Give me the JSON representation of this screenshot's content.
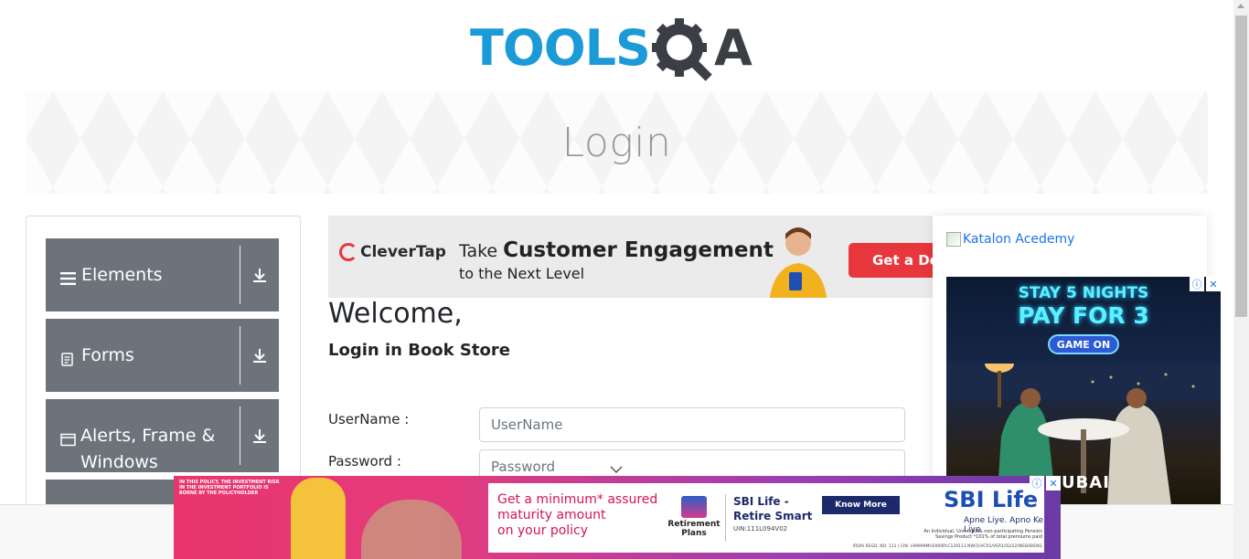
{
  "logo": {
    "tools": "TOOLS",
    "qa": "A"
  },
  "banner": {
    "title": "Login"
  },
  "sidebar": {
    "groups": [
      {
        "label": "Elements",
        "icon": "hamburger-icon"
      },
      {
        "label": "Forms",
        "icon": "document-icon"
      },
      {
        "label": "Alerts, Frame & Windows",
        "icon": "window-icon"
      }
    ]
  },
  "top_ad": {
    "brand": "CleverTap",
    "line1_prefix": "Take",
    "line1_bold": "Customer Engagement",
    "line2": "to the Next Level",
    "cta": "Get a De"
  },
  "login": {
    "welcome": "Welcome,",
    "subtitle": "Login in Book Store",
    "username_label": "UserName :",
    "username_placeholder": "UserName",
    "password_label": "Password :",
    "password_placeholder": "Password"
  },
  "right_sidebar": {
    "katalon_alt": "Katalon Acedemy",
    "ad": {
      "line1": "STAY 5 NIGHTS",
      "line2": "PAY FOR 3",
      "button": "GAME ON",
      "brand": "DUBAI"
    }
  },
  "bottom_ad": {
    "disclaimer": "IN THIS POLICY, THE INVESTMENT RISK IN THE INVESTMENT PORTFOLIO IS BORNE BY THE POLICYHOLDER",
    "copy_line1": "Get a minimum* assured",
    "copy_line2": "maturity amount",
    "copy_line3": "on your policy",
    "rp_line1": "Retirement",
    "rp_line2": "Plans",
    "product_line1": "SBI Life -",
    "product_line2": "Retire Smart",
    "uin": "UIN:111L094V02",
    "know_more": "Know More",
    "logo": "SBI Life",
    "tagline": "Apne Liye. Apno Ke Liye.",
    "fine_print": "An Individual, Unit-linked, non-participating Pension Savings Product *101% of total premiums paid",
    "irda": "IRDAI REGD. NO. 111 | CIN: L99999MH2000PLC129113 NW/1H/CR1/VER1/02/22/WEB/B/ENG"
  },
  "colors": {
    "brand_blue": "#1a9ad6",
    "sidebar_group": "#6c737b",
    "link": "#1a73e8"
  }
}
